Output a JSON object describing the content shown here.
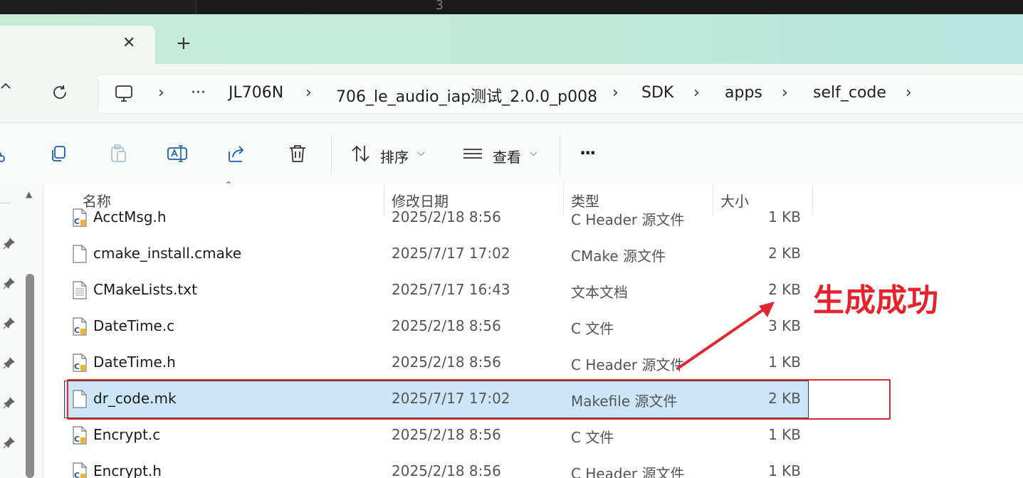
{
  "editor": {
    "line_number": "3"
  },
  "window": {
    "close_tab_glyph": "✕",
    "new_tab_glyph": "+"
  },
  "breadcrumb": {
    "more": "···",
    "items": [
      "JL706N",
      "706_le_audio_iap测试_2.0.0_p008",
      "SDK",
      "apps",
      "self_code"
    ]
  },
  "toolbar": {
    "sort_label": "排序",
    "view_label": "查看",
    "more_label": "···"
  },
  "columns": {
    "name": "名称",
    "date": "修改日期",
    "type": "类型",
    "size": "大小"
  },
  "files": [
    {
      "name": "AcctMsg.h",
      "date": "2025/2/18 8:56",
      "type": "C Header 源文件",
      "size": "1 KB",
      "icon": "c-header-icon"
    },
    {
      "name": "cmake_install.cmake",
      "date": "2025/7/17 17:02",
      "type": "CMake 源文件",
      "size": "2 KB",
      "icon": "document-icon"
    },
    {
      "name": "CMakeLists.txt",
      "date": "2025/7/17 16:43",
      "type": "文本文档",
      "size": "2 KB",
      "icon": "text-document-icon"
    },
    {
      "name": "DateTime.c",
      "date": "2025/2/18 8:56",
      "type": "C 文件",
      "size": "3 KB",
      "icon": "c-file-icon"
    },
    {
      "name": "DateTime.h",
      "date": "2025/2/18 8:56",
      "type": "C Header 源文件",
      "size": "1 KB",
      "icon": "c-header-icon"
    },
    {
      "name": "dr_code.mk",
      "date": "2025/7/17 17:02",
      "type": "Makefile 源文件",
      "size": "2 KB",
      "icon": "document-icon",
      "selected": true
    },
    {
      "name": "Encrypt.c",
      "date": "2025/2/18 8:56",
      "type": "C 文件",
      "size": "1 KB",
      "icon": "c-file-icon"
    },
    {
      "name": "Encrypt.h",
      "date": "2025/2/18 8:56",
      "type": "C Header 源文件",
      "size": "1 KB",
      "icon": "c-header-icon"
    }
  ],
  "annotation": {
    "text": "生成成功",
    "color": "#e8222b"
  },
  "colors": {
    "selection": "#cce6f8",
    "accent_red": "#e0262e"
  }
}
